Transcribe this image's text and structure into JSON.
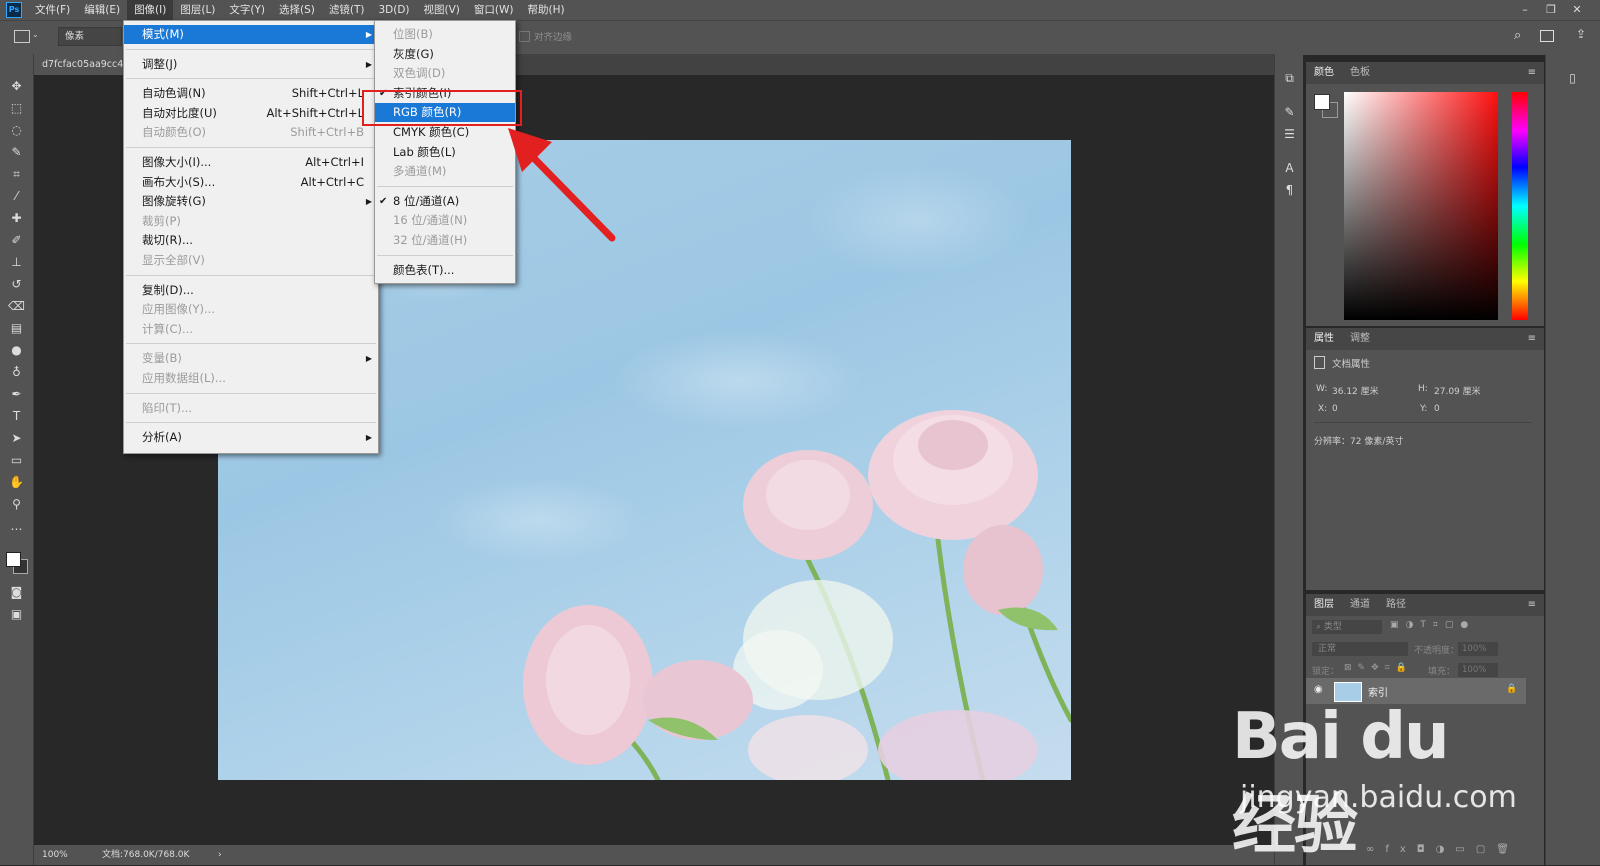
{
  "app": {
    "logo": "Ps"
  },
  "menubar": [
    "文件(F)",
    "编辑(E)",
    "图像(I)",
    "图层(L)",
    "文字(Y)",
    "选择(S)",
    "滤镜(T)",
    "3D(D)",
    "视图(V)",
    "窗口(W)",
    "帮助(H)"
  ],
  "menubar_active_index": 2,
  "window_controls": {
    "minimize": "–",
    "restore": "❐",
    "close": "✕"
  },
  "options_bar": {
    "unit_select": "像素",
    "align_edges": "对齐边缘"
  },
  "document": {
    "tab_title": "d7fcfac05aa9cc4?"
  },
  "status": {
    "zoom": "100%",
    "doc_size": "文档:768.0K/768.0K",
    "arrow": "›"
  },
  "image_menu": {
    "items": [
      {
        "label": "模式(M)",
        "shortcut": "",
        "submenu": true,
        "highlighted": true,
        "disabled": false
      },
      {
        "sep": true
      },
      {
        "label": "调整(J)",
        "shortcut": "",
        "submenu": true,
        "disabled": false
      },
      {
        "sep": true
      },
      {
        "label": "自动色调(N)",
        "shortcut": "Shift+Ctrl+L",
        "disabled": false
      },
      {
        "label": "自动对比度(U)",
        "shortcut": "Alt+Shift+Ctrl+L",
        "disabled": false
      },
      {
        "label": "自动颜色(O)",
        "shortcut": "Shift+Ctrl+B",
        "disabled": true
      },
      {
        "sep": true
      },
      {
        "label": "图像大小(I)...",
        "shortcut": "Alt+Ctrl+I",
        "disabled": false
      },
      {
        "label": "画布大小(S)...",
        "shortcut": "Alt+Ctrl+C",
        "disabled": false
      },
      {
        "label": "图像旋转(G)",
        "shortcut": "",
        "submenu": true,
        "disabled": false
      },
      {
        "label": "裁剪(P)",
        "shortcut": "",
        "disabled": true
      },
      {
        "label": "裁切(R)...",
        "shortcut": "",
        "disabled": false
      },
      {
        "label": "显示全部(V)",
        "shortcut": "",
        "disabled": true
      },
      {
        "sep": true
      },
      {
        "label": "复制(D)...",
        "shortcut": "",
        "disabled": false
      },
      {
        "label": "应用图像(Y)...",
        "shortcut": "",
        "disabled": true
      },
      {
        "label": "计算(C)...",
        "shortcut": "",
        "disabled": true
      },
      {
        "sep": true
      },
      {
        "label": "变量(B)",
        "shortcut": "",
        "submenu": true,
        "disabled": true
      },
      {
        "label": "应用数据组(L)...",
        "shortcut": "",
        "disabled": true
      },
      {
        "sep": true
      },
      {
        "label": "陷印(T)...",
        "shortcut": "",
        "disabled": true
      },
      {
        "sep": true
      },
      {
        "label": "分析(A)",
        "shortcut": "",
        "submenu": true,
        "disabled": false
      }
    ]
  },
  "mode_submenu": {
    "items": [
      {
        "label": "位图(B)",
        "disabled": true,
        "checked": false
      },
      {
        "label": "灰度(G)",
        "disabled": false,
        "checked": false
      },
      {
        "label": "双色调(D)",
        "disabled": true,
        "checked": false
      },
      {
        "label": "索引颜色(I)",
        "disabled": false,
        "checked": true
      },
      {
        "label": "RGB 颜色(R)",
        "disabled": false,
        "checked": false,
        "highlighted": true
      },
      {
        "label": "CMYK 颜色(C)",
        "disabled": false,
        "checked": false
      },
      {
        "label": "Lab 颜色(L)",
        "disabled": false,
        "checked": false
      },
      {
        "label": "多通道(M)",
        "disabled": true,
        "checked": false
      },
      {
        "sep": true
      },
      {
        "label": "8 位/通道(A)",
        "disabled": false,
        "checked": true
      },
      {
        "label": "16 位/通道(N)",
        "disabled": true,
        "checked": false
      },
      {
        "label": "32 位/通道(H)",
        "disabled": true,
        "checked": false
      },
      {
        "sep": true
      },
      {
        "label": "颜色表(T)...",
        "disabled": false,
        "checked": false
      }
    ]
  },
  "color_panel": {
    "tabs": [
      "颜色",
      "色板"
    ],
    "menu_icon": "≡"
  },
  "properties_panel": {
    "tabs": [
      "属性",
      "调整"
    ],
    "section": "文档属性",
    "w_label": "W:",
    "w_value": "36.12 厘米",
    "h_label": "H:",
    "h_value": "27.09 厘米",
    "x_label": "X:",
    "x_value": "0",
    "y_label": "Y:",
    "y_value": "0",
    "resolution": "分辨率：72 像素/英寸"
  },
  "layers_panel": {
    "tabs": [
      "图层",
      "通道",
      "路径"
    ],
    "filter_placeholder": "类型",
    "blend_mode": "正常",
    "opacity_label": "不透明度：",
    "opacity_value": "100%",
    "lock_label": "锁定：",
    "fill_label": "填充：",
    "fill_value": "100%",
    "layer_name": "索引"
  },
  "watermark": {
    "logo": "Bai du 经验",
    "url": "jingyan.baidu.com"
  },
  "colors": {
    "menu_highlight": "#1a78d6",
    "annotation_red": "#e32020",
    "ui_gray": "#535353"
  }
}
